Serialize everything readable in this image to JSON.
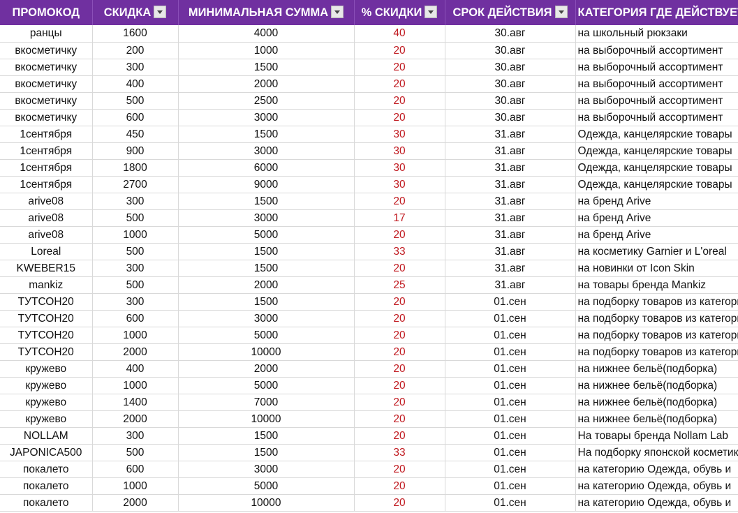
{
  "columns": [
    {
      "label": "ПРОМОКОД",
      "filter": false
    },
    {
      "label": "СКИДКА",
      "filter": true
    },
    {
      "label": "МИНИМАЛЬНАЯ СУММА",
      "filter": true
    },
    {
      "label": "% СКИДКИ",
      "filter": true
    },
    {
      "label": "СРОК ДЕЙСТВИЯ",
      "filter": true
    },
    {
      "label": "КАТЕГОРИЯ ГДЕ ДЕЙСТВУЕТ",
      "filter": false
    }
  ],
  "colors": {
    "header_bg": "#7030a0",
    "header_text": "#ffffff",
    "percent_text": "#c0191f",
    "gridline": "#d9d9d9"
  },
  "rows": [
    [
      "ранцы",
      "1600",
      "4000",
      "40",
      "30.авг",
      "на школьный рюкзаки"
    ],
    [
      "вкосметичку",
      "200",
      "1000",
      "20",
      "30.авг",
      "на выборочный ассортимент"
    ],
    [
      "вкосметичку",
      "300",
      "1500",
      "20",
      "30.авг",
      "на выборочный ассортимент"
    ],
    [
      "вкосметичку",
      "400",
      "2000",
      "20",
      "30.авг",
      "на выборочный ассортимент"
    ],
    [
      "вкосметичку",
      "500",
      "2500",
      "20",
      "30.авг",
      "на выборочный ассортимент"
    ],
    [
      "вкосметичку",
      "600",
      "3000",
      "20",
      "30.авг",
      "на выборочный ассортимент"
    ],
    [
      "1сентября",
      "450",
      "1500",
      "30",
      "31.авг",
      "Одежда, канцелярские товары"
    ],
    [
      "1сентября",
      "900",
      "3000",
      "30",
      "31.авг",
      "Одежда, канцелярские товары"
    ],
    [
      "1сентября",
      "1800",
      "6000",
      "30",
      "31.авг",
      "Одежда, канцелярские товары"
    ],
    [
      "1сентября",
      "2700",
      "9000",
      "30",
      "31.авг",
      "Одежда, канцелярские товары"
    ],
    [
      "arive08",
      "300",
      "1500",
      "20",
      "31.авг",
      "на бренд Arive"
    ],
    [
      "arive08",
      "500",
      "3000",
      "17",
      "31.авг",
      "на бренд Arive"
    ],
    [
      "arive08",
      "1000",
      "5000",
      "20",
      "31.авг",
      "на бренд Arive"
    ],
    [
      "Loreal",
      "500",
      "1500",
      "33",
      "31.авг",
      "на косметику Garnier и L'oreal"
    ],
    [
      "KWEBER15",
      "300",
      "1500",
      "20",
      "31.авг",
      "на новинки от Icon Skin"
    ],
    [
      "mankiz",
      "500",
      "2000",
      "25",
      "31.авг",
      "на товары бренда Mankiz"
    ],
    [
      "ТУТСОН20",
      "300",
      "1500",
      "20",
      "01.сен",
      "на подборку товаров из категории"
    ],
    [
      "ТУТСОН20",
      "600",
      "3000",
      "20",
      "01.сен",
      "на подборку товаров из категории"
    ],
    [
      "ТУТСОН20",
      "1000",
      "5000",
      "20",
      "01.сен",
      "на подборку товаров из категории"
    ],
    [
      "ТУТСОН20",
      "2000",
      "10000",
      "20",
      "01.сен",
      "на подборку товаров из категории"
    ],
    [
      "кружево",
      "400",
      "2000",
      "20",
      "01.сен",
      "на нижнее бельё(подборка)"
    ],
    [
      "кружево",
      "1000",
      "5000",
      "20",
      "01.сен",
      "на нижнее бельё(подборка)"
    ],
    [
      "кружево",
      "1400",
      "7000",
      "20",
      "01.сен",
      "на нижнее бельё(подборка)"
    ],
    [
      "кружево",
      "2000",
      "10000",
      "20",
      "01.сен",
      "на нижнее бельё(подборка)"
    ],
    [
      "NOLLAM",
      "300",
      "1500",
      "20",
      "01.сен",
      "На товары бренда Nollam Lab"
    ],
    [
      "JAPONICA500",
      "500",
      "1500",
      "33",
      "01.сен",
      "На подборку японской косметики"
    ],
    [
      "покалето",
      "600",
      "3000",
      "20",
      "01.сен",
      "на категорию Одежда, обувь и"
    ],
    [
      "покалето",
      "1000",
      "5000",
      "20",
      "01.сен",
      "на категорию Одежда, обувь и"
    ],
    [
      "покалето",
      "2000",
      "10000",
      "20",
      "01.сен",
      "на категорию Одежда, обувь и"
    ]
  ]
}
